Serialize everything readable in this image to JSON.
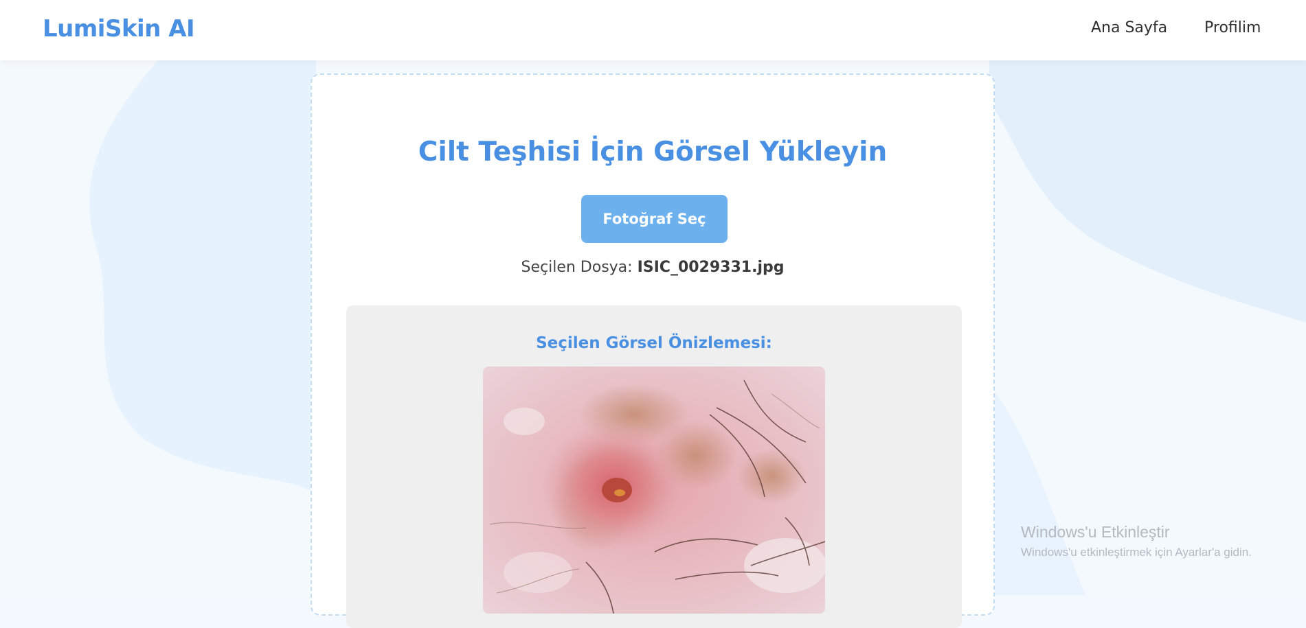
{
  "nav": {
    "logo": "LumiSkin AI",
    "links": [
      {
        "label": "Ana Sayfa"
      },
      {
        "label": "Profilim"
      }
    ]
  },
  "upload": {
    "title": "Cilt Teşhisi İçin Görsel Yükleyin",
    "choose_button": "Fotoğraf Seç",
    "selected_label": "Seçilen Dosya:",
    "selected_file": "ISIC_0029331.jpg"
  },
  "preview": {
    "title": "Seçilen Görsel Önizlemesi:"
  },
  "watermark": {
    "title": "Windows'u Etkinleştir",
    "subtitle": "Windows'u etkinleştirmek için Ayarlar'a gidin."
  },
  "colors": {
    "accent": "#4a90e2",
    "button": "#6cb0ee",
    "background": "#f3f9fe",
    "preview_bg": "#efefef"
  }
}
